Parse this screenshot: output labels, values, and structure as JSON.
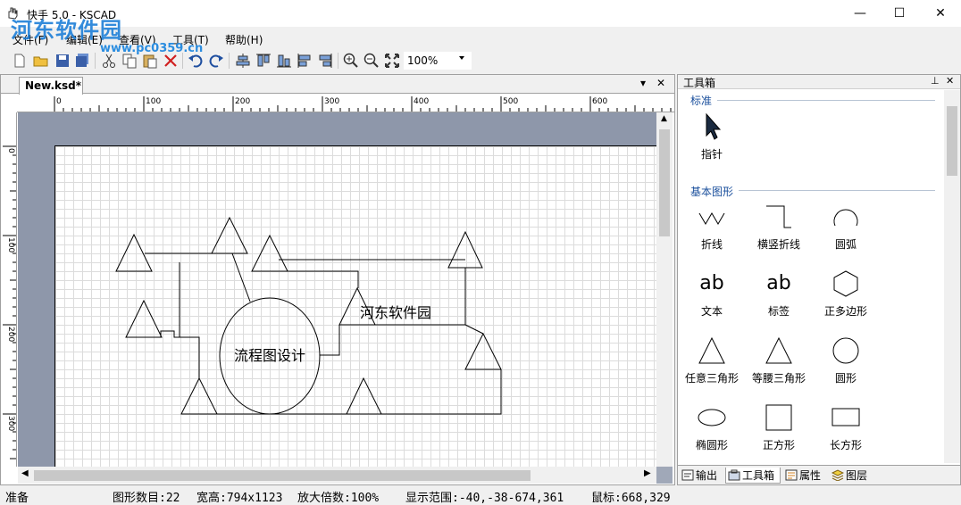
{
  "window": {
    "title": "快手 5.0 - KSCAD",
    "minimize": "—",
    "maximize": "☐",
    "close": "✕"
  },
  "watermark": {
    "text": "河东软件园",
    "url": "www.pc0359.cn"
  },
  "menu": [
    "文件(F)",
    "编辑(E)",
    "查看(V)",
    "工具(T)",
    "帮助(H)"
  ],
  "toolbar": {
    "zoom": "100%"
  },
  "document": {
    "tab": "New.ksd*",
    "dropdown_icon": "▾",
    "close_icon": "✕"
  },
  "ruler": {
    "h_labels": [
      "0",
      "100",
      "200",
      "300",
      "400",
      "500",
      "600"
    ],
    "v_labels": [
      "0",
      "100",
      "200",
      "300"
    ]
  },
  "canvas": {
    "label_main": "流程图设计",
    "label_secondary": "河东软件园"
  },
  "toolbox": {
    "title": "工具箱",
    "section_standard": "标准",
    "section_basic": "基本图形",
    "pointer": "指针",
    "tools": [
      "折线",
      "横竖折线",
      "圆弧",
      "文本",
      "标签",
      "正多边形",
      "任意三角形",
      "等腰三角形",
      "圆形",
      "椭圆形",
      "正方形",
      "长方形"
    ],
    "text_icon": "ab",
    "label_icon": "ab"
  },
  "panel_tabs": [
    "输出",
    "工具箱",
    "属性",
    "图层"
  ],
  "status": {
    "ready": "准备",
    "shape_count": "图形数目:22",
    "size": "宽高:794x1123",
    "zoom": "放大倍数:100%",
    "range": "显示范围:-40,-38-674,361",
    "mouse": "鼠标:668,329"
  }
}
